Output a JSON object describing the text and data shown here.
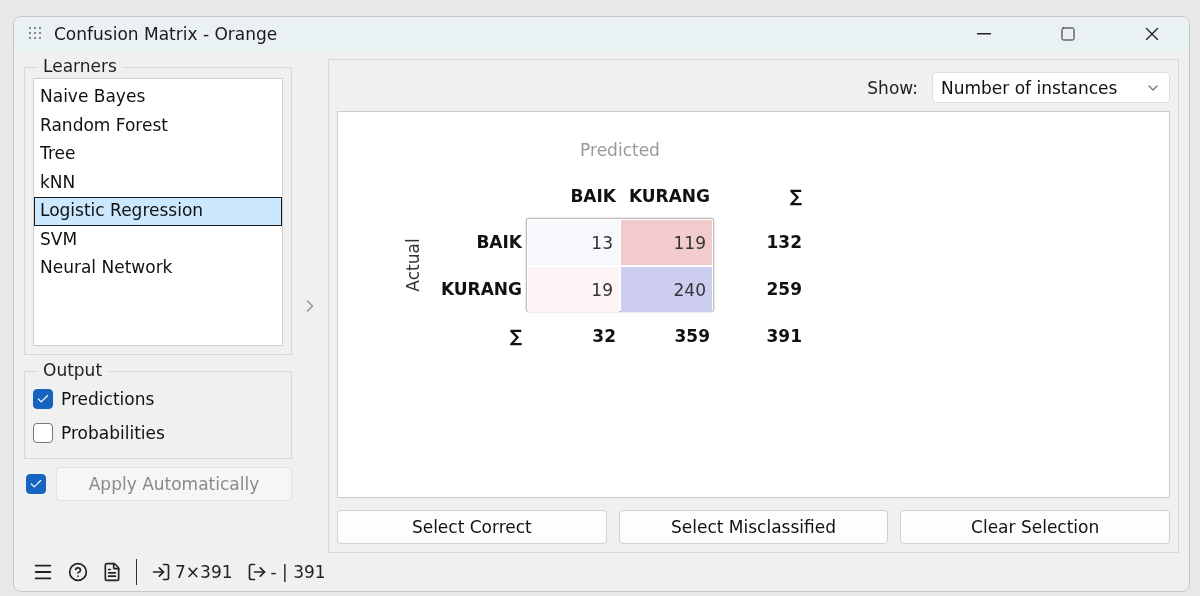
{
  "window": {
    "title": "Confusion Matrix - Orange"
  },
  "learners": {
    "title": "Learners",
    "items": [
      {
        "label": "Naive Bayes",
        "selected": false
      },
      {
        "label": "Random Forest",
        "selected": false
      },
      {
        "label": "Tree",
        "selected": false
      },
      {
        "label": "kNN",
        "selected": false
      },
      {
        "label": "Logistic Regression",
        "selected": true
      },
      {
        "label": "SVM",
        "selected": false
      },
      {
        "label": "Neural Network",
        "selected": false
      }
    ]
  },
  "output": {
    "title": "Output",
    "options": [
      {
        "label": "Predictions",
        "checked": true
      },
      {
        "label": "Probabilities",
        "checked": false
      }
    ]
  },
  "apply": {
    "label": "Apply Automatically",
    "checked": true
  },
  "show": {
    "label": "Show:",
    "value": "Number of instances"
  },
  "matrix": {
    "predicted_label": "Predicted",
    "actual_label": "Actual",
    "columns": [
      "BAIK",
      "KURANG"
    ],
    "sum_symbol": "∑",
    "rows": [
      {
        "label": "BAIK",
        "cells": [
          {
            "value": "13",
            "color": "#f8f9fd"
          },
          {
            "value": "119",
            "color": "#f2cccc"
          }
        ],
        "total": "132"
      },
      {
        "label": "KURANG",
        "cells": [
          {
            "value": "19",
            "color": "#fdf5f5"
          },
          {
            "value": "240",
            "color": "#cdcdf0"
          }
        ],
        "total": "259"
      }
    ],
    "sum_label": "∑",
    "column_totals": [
      "32",
      "359"
    ],
    "grand_total": "391"
  },
  "buttons": [
    "Select Correct",
    "Select Misclassified",
    "Clear Selection"
  ],
  "status_bar": {
    "input": "7×391",
    "output": "- | 391"
  }
}
